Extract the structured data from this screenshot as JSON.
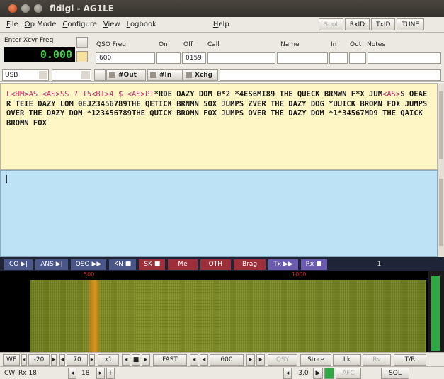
{
  "window": {
    "title": "fldigi - AG1LE"
  },
  "menu": {
    "items": [
      {
        "underlined": "F",
        "rest": "ile"
      },
      {
        "underlined": "O",
        "rest": "p Mode"
      },
      {
        "underlined": "C",
        "rest": "onfigure"
      },
      {
        "underlined": "V",
        "rest": "iew"
      },
      {
        "underlined": "L",
        "rest": "ogbook"
      },
      {
        "underlined": "H",
        "rest": "elp"
      }
    ],
    "spot": "Spot",
    "rxid": "RxID",
    "txid": "TxID",
    "tune": "TUNE"
  },
  "log": {
    "enter_freq_label": "Enter Xcvr Freq",
    "freq_display": "0.000",
    "qso_freq_label": "QSO Freq",
    "qso_freq_value": "600",
    "on_label": "On",
    "off_label": "Off",
    "off_value": "0159",
    "call_label": "Call",
    "name_label": "Name",
    "in_label": "In",
    "out_label": "Out",
    "notes_label": "Notes",
    "mode_value": "USB",
    "out_btn": "#Out",
    "in_btn": "#In",
    "xchg_btn": "Xchg"
  },
  "rx": {
    "segments": [
      {
        "text": "L<HM>AS <AS>SS ? T5<BT>4 $ <AS>PI",
        "ctl": true
      },
      {
        "text": "*RDE DAZY DOM θ*2 *4ES6MI89 THE QUECK BRMWN F*X JUM",
        "ctl": false
      },
      {
        "text": "<AS>",
        "ctl": true
      },
      {
        "text": "S OEAER TEIE DAZY LOM θEJ23456789THE QETICK BRNMN 5OX JUMPS ZVER THE DAZY DOG *UUICK BROMN FOX JUMPS OVER THE DAZY DOM *123456789THE QUICK BROMN FOX JUMPS OVER THE DAZY DOM *1*34567MD9 THE QAICK BROMN FOX",
        "ctl": false
      }
    ]
  },
  "macros": [
    {
      "label": "CQ",
      "style": "blue",
      "mark": "▶|"
    },
    {
      "label": "ANS",
      "style": "blue",
      "mark": "▶|"
    },
    {
      "label": "QSO",
      "style": "blue",
      "mark": "▶▶"
    },
    {
      "label": "KN",
      "style": "blue",
      "mark": "■"
    },
    {
      "label": "SK",
      "style": "red",
      "mark": "■"
    },
    {
      "label": "Me",
      "style": "red",
      "mark": ""
    },
    {
      "label": "QTH",
      "style": "red",
      "mark": ""
    },
    {
      "label": "Brag",
      "style": "red",
      "mark": ""
    },
    {
      "label": "Tx",
      "style": "lav",
      "mark": "▶▶"
    },
    {
      "label": "Rx",
      "style": "lav",
      "mark": "■"
    }
  ],
  "macro_page": "1",
  "waterfall": {
    "ruler_labels": [
      "500",
      "1000"
    ]
  },
  "controls": {
    "wf": "WF",
    "ref": "-20",
    "range": "70",
    "zoom": "x1",
    "speed": "FAST",
    "freq": "600",
    "qsy": "QSY",
    "store": "Store",
    "lk": "Lk",
    "rv": "Rv",
    "tr": "T/R"
  },
  "status": {
    "mode": "CW",
    "rx": "Rx 18",
    "tx": "18",
    "s2n": "-3.0",
    "afc": "AFC",
    "sql": "SQL"
  },
  "colors": {
    "rx_bg": "#fff6c6",
    "tx_bg": "#bde2f6",
    "freq_green": "#3dd14a",
    "macro_blue": "#4a5688",
    "macro_red": "#9d2f3b",
    "macro_lav": "#6b5bb0"
  }
}
